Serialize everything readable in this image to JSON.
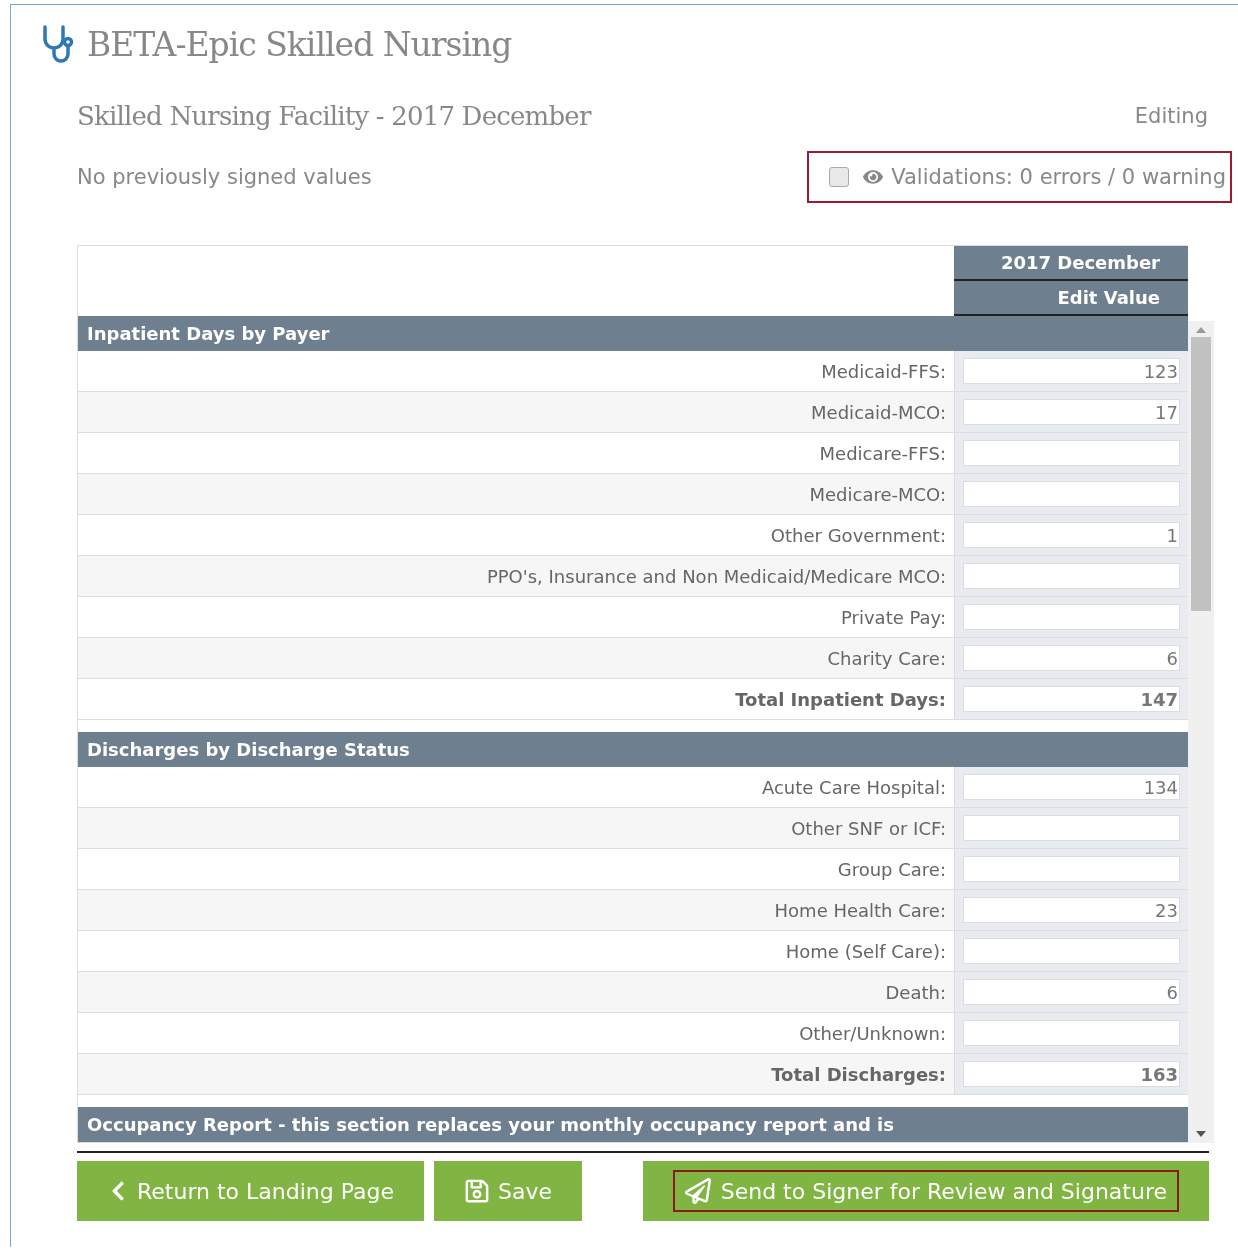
{
  "app_title": "BETA-Epic Skilled Nursing",
  "report_title": "Skilled Nursing Facility - 2017 December",
  "mode": "Editing",
  "signed_note": "No previously signed values",
  "validations": {
    "checked": false,
    "text": "Validations: 0 errors / 0 warning"
  },
  "table": {
    "column_period": "2017 December",
    "column_action": "Edit Value",
    "sections": [
      {
        "title": "Inpatient Days by Payer",
        "rows": [
          {
            "label": "Medicaid-FFS:",
            "value": "123",
            "total": false
          },
          {
            "label": "Medicaid-MCO:",
            "value": "17",
            "total": false
          },
          {
            "label": "Medicare-FFS:",
            "value": "",
            "total": false
          },
          {
            "label": "Medicare-MCO:",
            "value": "",
            "total": false
          },
          {
            "label": "Other Government:",
            "value": "1",
            "total": false
          },
          {
            "label": "PPO's, Insurance and Non Medicaid/Medicare MCO:",
            "value": "",
            "total": false
          },
          {
            "label": "Private Pay:",
            "value": "",
            "total": false
          },
          {
            "label": "Charity Care:",
            "value": "6",
            "total": false
          },
          {
            "label": "Total Inpatient Days:",
            "value": "147",
            "total": true
          }
        ]
      },
      {
        "title": "Discharges by Discharge Status",
        "rows": [
          {
            "label": "Acute Care Hospital:",
            "value": "134",
            "total": false
          },
          {
            "label": "Other SNF or ICF:",
            "value": "",
            "total": false
          },
          {
            "label": "Group Care:",
            "value": "",
            "total": false
          },
          {
            "label": "Home Health Care:",
            "value": "23",
            "total": false
          },
          {
            "label": "Home (Self Care):",
            "value": "",
            "total": false
          },
          {
            "label": "Death:",
            "value": "6",
            "total": false
          },
          {
            "label": "Other/Unknown:",
            "value": "",
            "total": false
          },
          {
            "label": "Total Discharges:",
            "value": "163",
            "total": true
          }
        ]
      },
      {
        "title": "Occupancy Report - this section replaces your monthly occupancy report and is"
      }
    ]
  },
  "buttons": [
    {
      "kind": "back",
      "label": "Return to Landing Page"
    },
    {
      "kind": "save",
      "label": "Save"
    },
    {
      "kind": "send",
      "label": "Send to Signer for Review and Signature"
    }
  ]
}
